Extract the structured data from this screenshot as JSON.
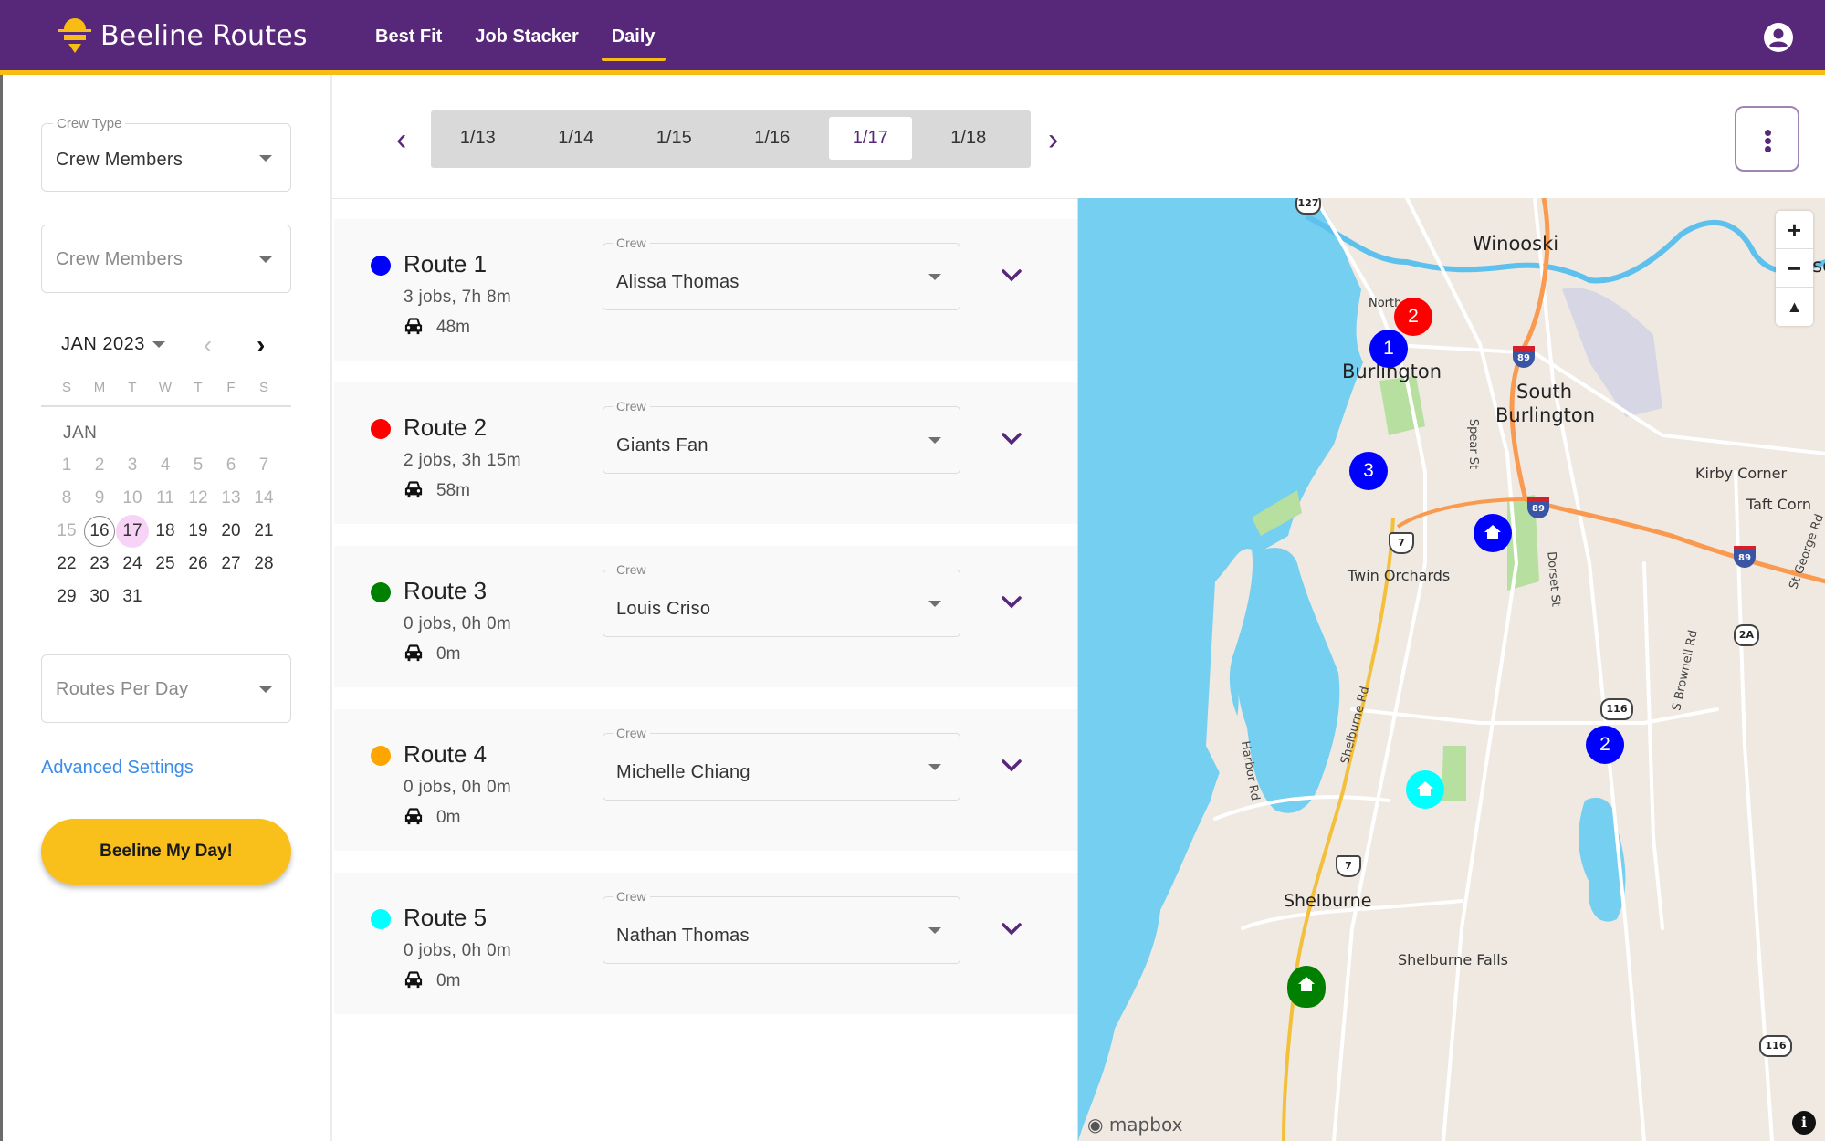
{
  "app": {
    "brand": "Beeline Routes",
    "colors": {
      "primary": "#57287a",
      "accent": "#f7bd15",
      "link": "#3b8ce8"
    }
  },
  "nav": {
    "items": [
      {
        "label": "Best Fit",
        "active": false
      },
      {
        "label": "Job Stacker",
        "active": false
      },
      {
        "label": "Daily",
        "active": true
      }
    ],
    "account_icon": "account-circle-icon"
  },
  "sidebar": {
    "crew_type": {
      "label": "Crew Type",
      "value": "Crew Members"
    },
    "crew_members": {
      "placeholder": "Crew Members"
    },
    "calendar": {
      "month_year": "JAN 2023",
      "weekdays": [
        "S",
        "M",
        "T",
        "W",
        "T",
        "F",
        "S"
      ],
      "month_label": "JAN",
      "days": [
        1,
        2,
        3,
        4,
        5,
        6,
        7,
        8,
        9,
        10,
        11,
        12,
        13,
        14,
        15,
        16,
        17,
        18,
        19,
        20,
        21,
        22,
        23,
        24,
        25,
        26,
        27,
        28,
        29,
        30,
        31
      ],
      "first_weekday_index": 0,
      "today": 16,
      "selected": 17,
      "past_before": 16
    },
    "routes_per_day": {
      "placeholder": "Routes Per Day"
    },
    "advanced_settings": "Advanced Settings",
    "action_button": "Beeline My Day!"
  },
  "date_strip": {
    "dates": [
      "1/13",
      "1/14",
      "1/15",
      "1/16",
      "1/17",
      "1/18"
    ],
    "active": "1/17"
  },
  "routes": [
    {
      "name": "Route 1",
      "color": "#0000ff",
      "summary": "3 jobs, 7h 8m",
      "drive": "48m",
      "crew_label": "Crew",
      "crew": "Alissa Thomas"
    },
    {
      "name": "Route 2",
      "color": "#ff0000",
      "summary": "2 jobs, 3h 15m",
      "drive": "58m",
      "crew_label": "Crew",
      "crew": "Giants Fan"
    },
    {
      "name": "Route 3",
      "color": "#008000",
      "summary": "0 jobs, 0h 0m",
      "drive": "0m",
      "crew_label": "Crew",
      "crew": "Louis Criso"
    },
    {
      "name": "Route 4",
      "color": "#ffa500",
      "summary": "0 jobs, 0h 0m",
      "drive": "0m",
      "crew_label": "Crew",
      "crew": "Michelle Chiang"
    },
    {
      "name": "Route 5",
      "color": "#00ffff",
      "summary": "0 jobs, 0h 0m",
      "drive": "0m",
      "crew_label": "Crew",
      "crew": "Nathan Thomas"
    }
  ],
  "map": {
    "labels": {
      "winooski": "Winooski",
      "essex": "Esse",
      "burlington": "Burlington",
      "south_burlington_1": "South",
      "south_burlington_2": "Burlington",
      "north_st": "North St",
      "kirby": "Kirby Corner",
      "taft": "Taft Corn",
      "twin_orchards": "Twin Orchards",
      "shelburne": "Shelburne",
      "shelburne_falls": "Shelburne Falls",
      "spear_st": "Spear St",
      "dorset_st": "Dorset St",
      "shelburne_rd": "Shelburne Rd",
      "harbor_rd": "Harbor Rd",
      "brownell_rd": "S Brownell Rd",
      "st_george": "St George Rd"
    },
    "shields": {
      "r127": "127",
      "us7": "7",
      "i89": "89",
      "r116": "116",
      "r2a": "2A"
    },
    "markers": [
      {
        "type": "stop",
        "label": "2",
        "route": "Route 2",
        "color": "#ff0000"
      },
      {
        "type": "stop",
        "label": "1",
        "route": "Route 1",
        "color": "#0000ff"
      },
      {
        "type": "stop",
        "label": "3",
        "route": "Route 1",
        "color": "#0000ff"
      },
      {
        "type": "home",
        "label": "",
        "route": "Route 1",
        "color": "#0000ff"
      },
      {
        "type": "stop",
        "label": "2",
        "route": "Route 1",
        "color": "#0000ff"
      },
      {
        "type": "home",
        "label": "",
        "route": "Route 5",
        "color": "#00ffff"
      },
      {
        "type": "home",
        "label": "",
        "route": "Route 3",
        "color": "#008000"
      }
    ],
    "zoom_in": "+",
    "zoom_out": "−",
    "compass": "▲",
    "attribution": "mapbox",
    "info": "i"
  }
}
